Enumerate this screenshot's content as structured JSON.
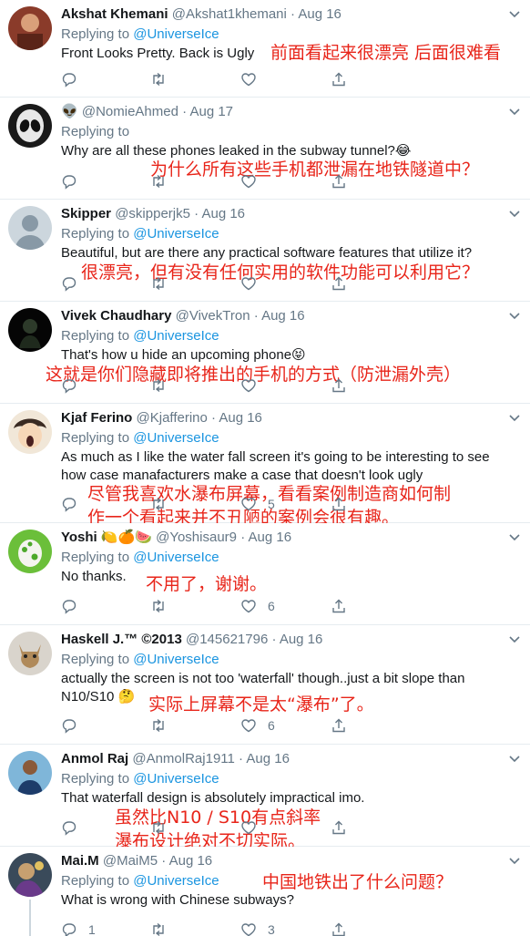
{
  "tweets": [
    {
      "name": "Akshat Khemani",
      "name_prefix": "",
      "handle": "@Akshat1khemani",
      "date": "Aug 16",
      "replying_label": "Replying to",
      "replying_to": "@UniverseIce",
      "text": "Front Looks Pretty. Back is Ugly",
      "translation": "前面看起来很漂亮 后面很难看",
      "counts": {
        "reply": "",
        "retweet": "",
        "like": ""
      }
    },
    {
      "name": "",
      "name_prefix": "👽",
      "handle": "@NomieAhmed",
      "date": "Aug 17",
      "replying_label": "Replying to",
      "replying_to": "",
      "text": "Why are all these phones leaked in the subway tunnel?😂",
      "translation": "为什么所有这些手机都泄漏在地铁隧道中？",
      "counts": {
        "reply": "",
        "retweet": "",
        "like": ""
      }
    },
    {
      "name": "Skipper",
      "name_prefix": "",
      "handle": "@skipperjk5",
      "date": "Aug 16",
      "replying_label": "Replying to",
      "replying_to": "@UniverseIce",
      "text": "Beautiful, but are there any practical software features that utilize it?",
      "translation": "很漂亮，但有没有任何实用的软件功能可以利用它？",
      "counts": {
        "reply": "",
        "retweet": "",
        "like": ""
      }
    },
    {
      "name": "Vivek Chaudhary",
      "name_prefix": "",
      "handle": "@VivekTron",
      "date": "Aug 16",
      "replying_label": "Replying to",
      "replying_to": "@UniverseIce",
      "text": "That's how u hide an upcoming phone😝",
      "translation": "这就是你们隐藏即将推出的手机的方式（防泄漏外壳）",
      "counts": {
        "reply": "",
        "retweet": "",
        "like": ""
      }
    },
    {
      "name": "Kjaf Ferino",
      "name_prefix": "",
      "handle": "@Kjafferino",
      "date": "Aug 16",
      "replying_label": "Replying to",
      "replying_to": "@UniverseIce",
      "text": "As much as I like the water fall screen it's going to be interesting to see how case manafacturers make a case that doesn't look ugly",
      "translation_lines": [
        "尽管我喜欢水瀑布屏幕，看看案例制造商如何制",
        "作一个看起来并不丑陋的案例会很有趣。"
      ],
      "counts": {
        "reply": "",
        "retweet": "",
        "like": "5"
      }
    },
    {
      "name": "Yoshi 🍋🍊🍉",
      "name_prefix": "",
      "handle": "@Yoshisaur9",
      "date": "Aug 16",
      "replying_label": "Replying to",
      "replying_to": "@UniverseIce",
      "text": "No thanks.",
      "translation": "不用了，谢谢。",
      "counts": {
        "reply": "",
        "retweet": "",
        "like": "6"
      }
    },
    {
      "name": "Haskell J.™ ©2013",
      "name_prefix": "",
      "handle": "@145621796",
      "date": "Aug 16",
      "replying_label": "Replying to",
      "replying_to": "@UniverseIce",
      "text": "actually the screen is not too 'waterfall' though..just a bit slope than N10/S10 🤔",
      "translation": "实际上屏幕不是太“瀑布”了。",
      "counts": {
        "reply": "",
        "retweet": "",
        "like": "6"
      }
    },
    {
      "name": "Anmol Raj",
      "name_prefix": "",
      "handle": "@AnmolRaj1911",
      "date": "Aug 16",
      "replying_label": "Replying to",
      "replying_to": "@UniverseIce",
      "text": "That waterfall design is absolutely impractical imo.",
      "translation_lines": [
        "虽然比N10 / S10有点斜率",
        "瀑布设计绝对不切实际。"
      ],
      "counts": {
        "reply": "",
        "retweet": "",
        "like": ""
      }
    },
    {
      "name": "Mai.M",
      "name_prefix": "",
      "handle": "@MaiM5",
      "date": "Aug 16",
      "replying_label": "Replying to",
      "replying_to": "@UniverseIce",
      "text": "What is wrong with Chinese subways?",
      "translation": "中国地铁出了什么问题？",
      "counts": {
        "reply": "1",
        "retweet": "",
        "like": "3"
      }
    }
  ],
  "colors": {
    "link": "#1b95e0",
    "muted": "#657786",
    "annotation": "#e8251a"
  }
}
